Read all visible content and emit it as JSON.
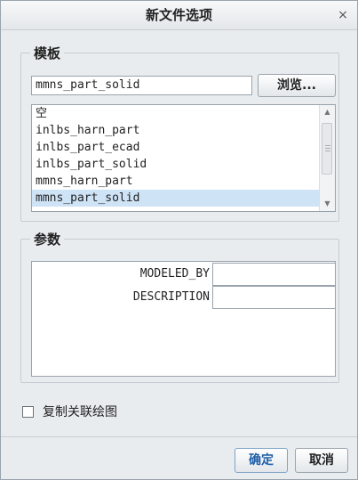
{
  "dialog": {
    "title": "新文件选项",
    "close_glyph": "×"
  },
  "template_group": {
    "legend": "模板",
    "input_value": "mmns_part_solid",
    "browse_label": "浏览...",
    "list": [
      "空",
      "inlbs_harn_part",
      "inlbs_part_ecad",
      "inlbs_part_solid",
      "mmns_harn_part",
      "mmns_part_solid"
    ],
    "selected_item": "mmns_part_solid"
  },
  "params_group": {
    "legend": "参数",
    "rows": [
      {
        "label": "MODELED_BY",
        "value": ""
      },
      {
        "label": "DESCRIPTION",
        "value": ""
      }
    ]
  },
  "copy_drawing": {
    "label": "复制关联绘图",
    "checked": false
  },
  "buttons": {
    "ok_label": "确定",
    "cancel_label": "取消"
  },
  "colors": {
    "selection": "#cfe3f6",
    "dialog_bg": "#e9ecef",
    "ok_text": "#1f5fa8"
  },
  "icons": {
    "close": "close-icon",
    "scroll_up": "chevron-up-icon",
    "scroll_down": "chevron-down-icon"
  }
}
